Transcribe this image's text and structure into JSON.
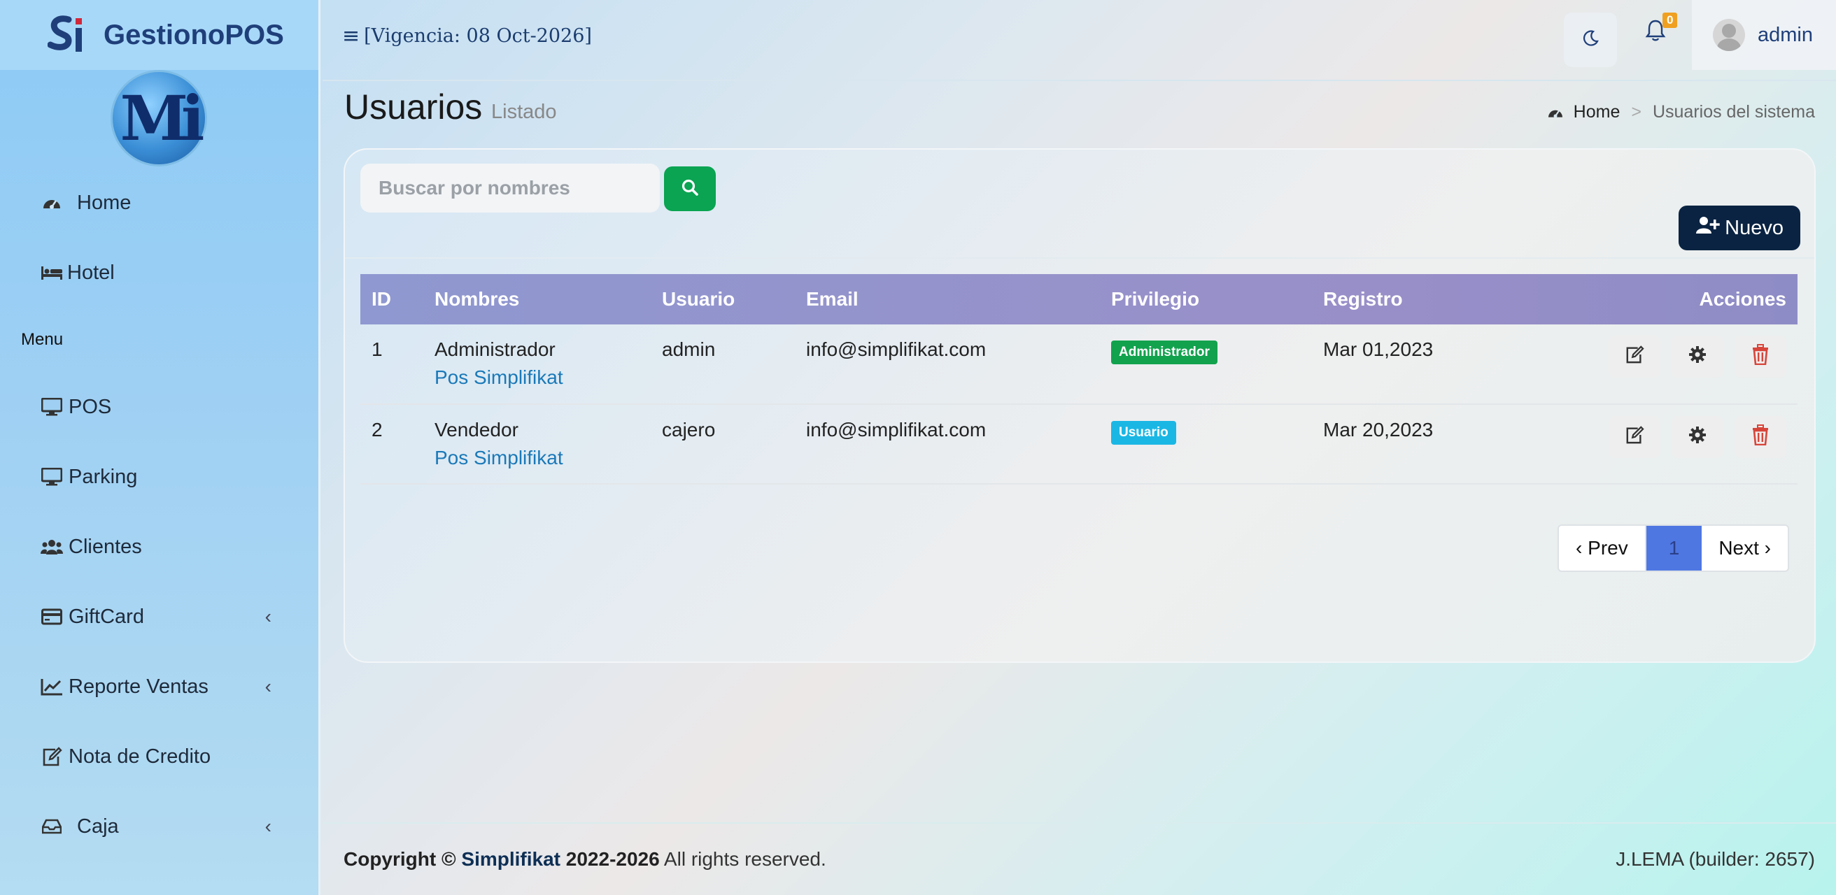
{
  "app": {
    "brand": "GestionoPOS",
    "logo_letters": "Mi"
  },
  "topbar": {
    "vigencia": "[Vigencia: 08 Oct-2026]",
    "notifications_count": "0",
    "user_name": "admin"
  },
  "sidebar": {
    "items_top": [
      {
        "label": "Home",
        "icon": "dashboard-icon"
      },
      {
        "label": "Hotel",
        "icon": "bed-icon"
      }
    ],
    "menu_header": "Menu",
    "items_menu": [
      {
        "label": "POS",
        "icon": "desktop-icon",
        "has_submenu": false
      },
      {
        "label": "Parking",
        "icon": "desktop-icon",
        "has_submenu": false
      },
      {
        "label": "Clientes",
        "icon": "users-icon",
        "has_submenu": false
      },
      {
        "label": "GiftCard",
        "icon": "credit-card-icon",
        "has_submenu": true
      },
      {
        "label": "Reporte Ventas",
        "icon": "line-chart-icon",
        "has_submenu": true
      },
      {
        "label": "Nota de Credito",
        "icon": "edit-icon",
        "has_submenu": false
      },
      {
        "label": "Caja",
        "icon": "inbox-icon",
        "has_submenu": true
      }
    ],
    "chevron": "‹"
  },
  "page": {
    "title": "Usuarios",
    "subtitle": "Listado",
    "breadcrumb": {
      "home": "Home",
      "separator": ">",
      "current": "Usuarios del sistema"
    }
  },
  "search": {
    "placeholder": "Buscar por nombres",
    "value": ""
  },
  "buttons": {
    "nuevo": "Nuevo"
  },
  "table": {
    "columns": [
      "ID",
      "Nombres",
      "Usuario",
      "Email",
      "Privilegio",
      "Registro",
      "Acciones"
    ],
    "rows": [
      {
        "id": "1",
        "nombre": "Administrador",
        "empresa": "Pos Simplifikat",
        "usuario": "admin",
        "email": "info@simplifikat.com",
        "privilegio": "Administrador",
        "privilegio_color": "#12a24e",
        "registro": "Mar 01,2023"
      },
      {
        "id": "2",
        "nombre": "Vendedor",
        "empresa": "Pos Simplifikat",
        "usuario": "cajero",
        "email": "info@simplifikat.com",
        "privilegio": "Usuario",
        "privilegio_color": "#1bb7e4",
        "registro": "Mar 20,2023"
      }
    ]
  },
  "pagination": {
    "prev": "‹ Prev",
    "current": "1",
    "next": "Next ›"
  },
  "footer": {
    "copyright_prefix": "Copyright ©",
    "company": "Simplifikat",
    "years": "2022-2026",
    "rights": "All rights reserved.",
    "builder": "J.LEMA (builder: 2657)"
  },
  "colors": {
    "accent_green": "#0aa452",
    "dark_navy": "#0a2342",
    "table_header": "#9695cb",
    "link_blue": "#1a79b8",
    "pager_active": "#4f77e2"
  }
}
